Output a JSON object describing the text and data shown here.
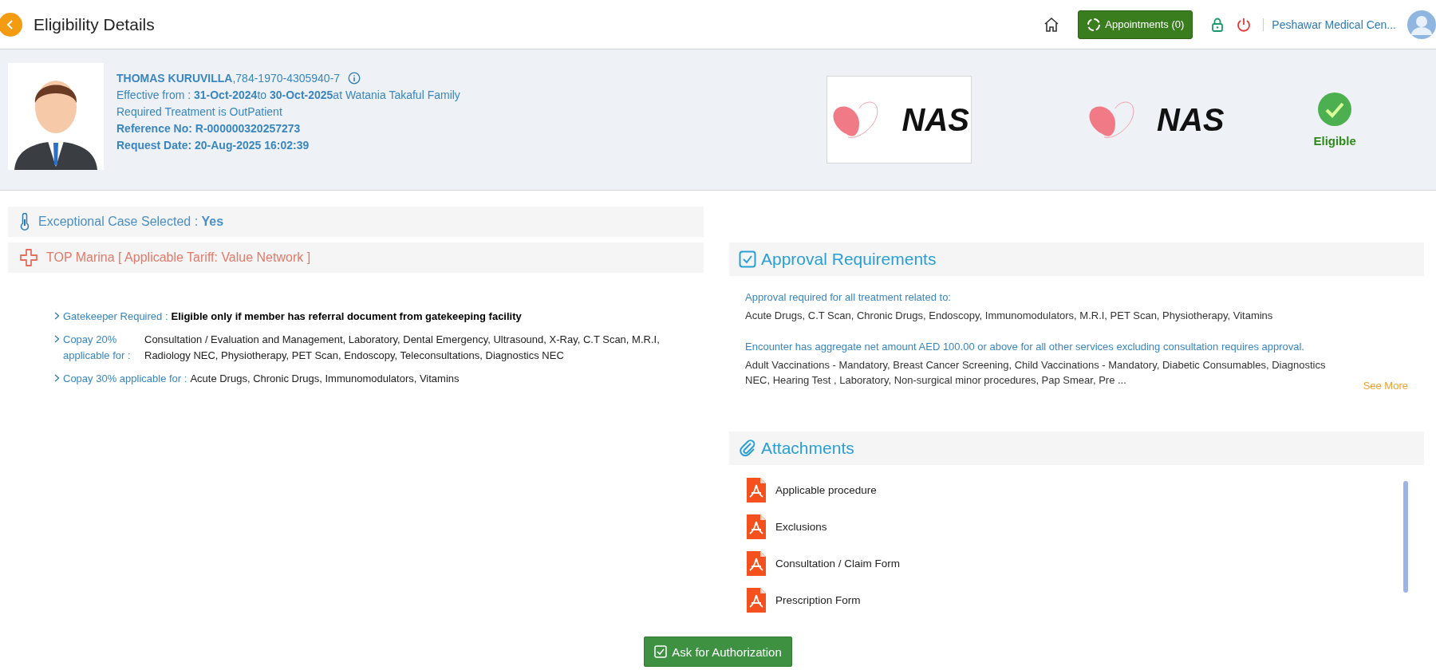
{
  "header": {
    "title": "Eligibility Details",
    "appointments": "Appointments (0)",
    "facility": "Peshawar Medical Cen..."
  },
  "patient": {
    "name_line": "**THOMAS KURUVILLA**,784-1970-4305940-7",
    "effective": "Effective from : **31-Oct-2024**to **30-Oct-2025**at Watania Takaful Family",
    "treatment": "Required Treatment is OutPatient",
    "reference": "Reference No: R-000000320257273",
    "request_date": "Request Date: 20-Aug-2025 16:02:39"
  },
  "logos": [
    {
      "text": "NAS",
      "framed": true
    },
    {
      "text": "NAS",
      "framed": false
    }
  ],
  "status": {
    "label": "Eligible",
    "eligible": true
  },
  "exceptional": "Exceptional Case Selected : **Yes**",
  "tariff": "TOP Marina [ Applicable Tariff: Value Network ]",
  "benefits": [
    {
      "label": "Gatekeeper Required :",
      "value": "Eligible only if member has referral document from gatekeeping facility",
      "kind": "emphasis"
    },
    {
      "label": "Copay 20% applicable for :",
      "value": "Consultation / Evaluation and Management, Laboratory, Dental Emergency, Ultrasound, X-Ray, C.T Scan, M.R.I, Radiology NEC, Physiotherapy, PET Scan, Endoscopy, Teleconsultations, Diagnostics NEC",
      "kind": "column"
    },
    {
      "label": "Copay 30% applicable for :",
      "value": "Acute Drugs, Chronic Drugs, Immunomodulators, Vitamins",
      "kind": "inline"
    }
  ],
  "approval": {
    "title": "Approval Requirements",
    "groups": [
      {
        "heading": "Approval required for all treatment related to:",
        "items": "Acute Drugs, C.T Scan, Chronic Drugs, Endoscopy, Immunomodulators, M.R.I, PET Scan, Physiotherapy, Vitamins"
      },
      {
        "heading": "Encounter has aggregate net amount AED 100.00 or above for all other services excluding consultation requires approval.",
        "items": "Adult Vaccinations - Mandatory, Breast Cancer Screening, Child Vaccinations - Mandatory, Diabetic Consumables, Diagnostics NEC, Hearing Test , Laboratory, Non-surgical minor procedures, Pap Smear, Pre ..."
      }
    ],
    "see_more": "See More"
  },
  "attachments": {
    "title": "Attachments",
    "files": [
      "Applicable procedure",
      "Exclusions",
      "Consultation / Claim Form",
      "Prescription Form"
    ]
  },
  "action": "Ask for Authorization"
}
